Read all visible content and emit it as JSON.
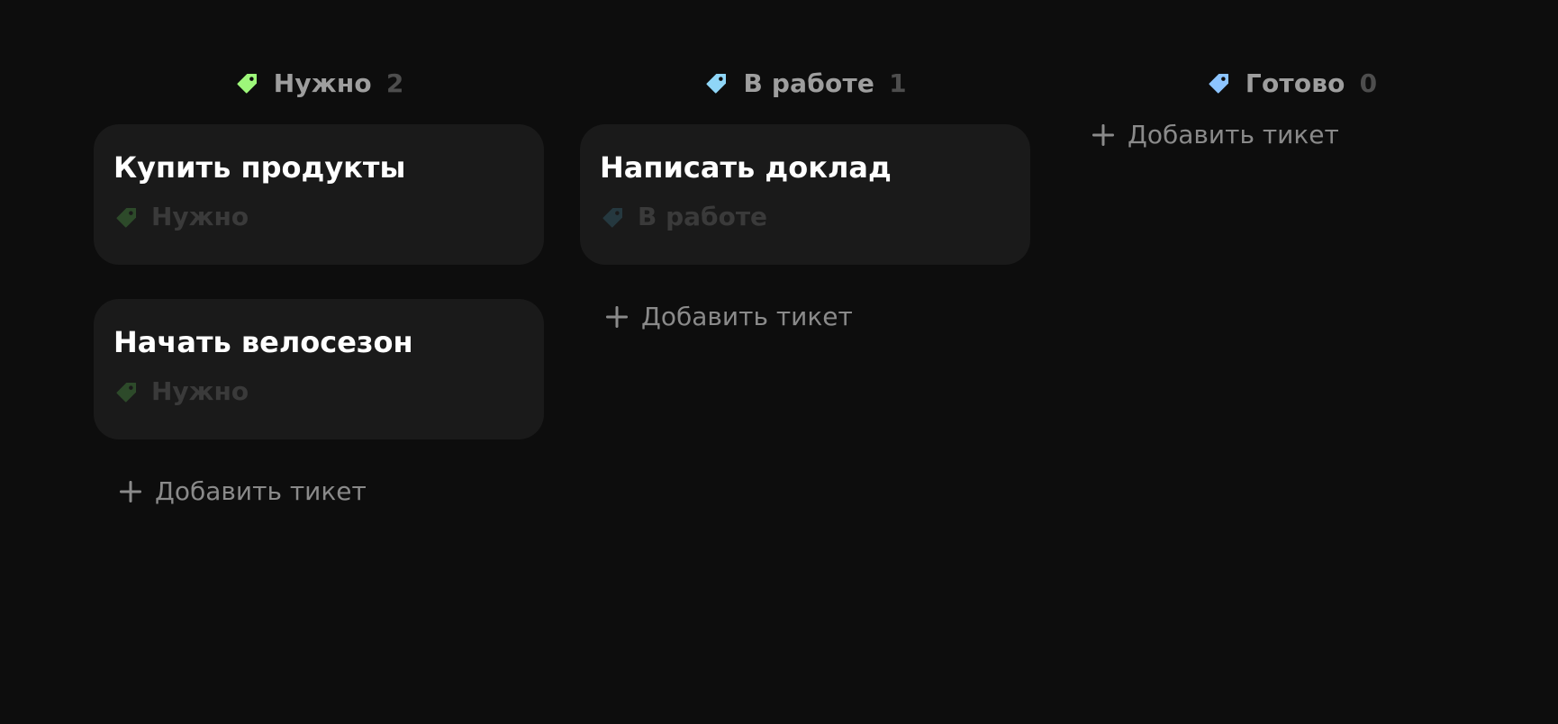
{
  "colors": {
    "background": "#0d0d0d",
    "card": "#1a1a1a",
    "tag_todo": "#9df77a",
    "tag_progress": "#8fd6f7",
    "tag_done": "#8cc4ff",
    "tag_todo_muted": "#2d4a2a",
    "tag_progress_muted": "#25383f"
  },
  "columns": [
    {
      "title": "Нужно",
      "count": "2",
      "icon": "tag-icon",
      "cards": [
        {
          "title": "Купить продукты",
          "tag": "Нужно"
        },
        {
          "title": "Начать велосезон",
          "tag": "Нужно"
        }
      ],
      "add_label": "Добавить тикет"
    },
    {
      "title": "В работе",
      "count": "1",
      "icon": "tag-icon",
      "cards": [
        {
          "title": "Написать доклад",
          "tag": "В работе"
        }
      ],
      "add_label": "Добавить тикет"
    },
    {
      "title": "Готово",
      "count": "0",
      "icon": "tag-icon",
      "cards": [],
      "add_label": "Добавить тикет"
    }
  ]
}
